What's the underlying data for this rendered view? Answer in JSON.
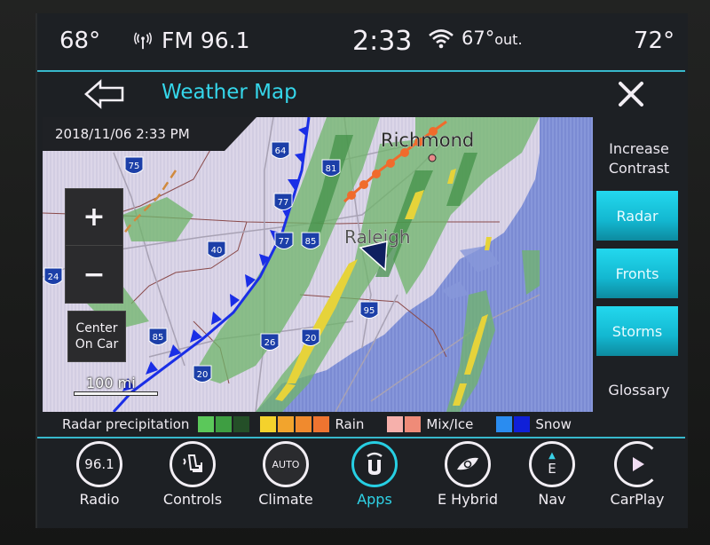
{
  "status_bar": {
    "driver_temp": "68°",
    "radio_icon": "radio-antenna-icon",
    "radio_station": "FM 96.1",
    "clock": "2:33",
    "wifi_icon": "wifi-icon",
    "outside_temp": "67°",
    "outside_suffix": "out.",
    "passenger_temp": "72°"
  },
  "header": {
    "back_icon": "back-arrow-icon",
    "title": "Weather Map",
    "close_icon": "close-icon"
  },
  "map": {
    "timestamp": "2018/11/06  2:33 PM",
    "zoom_in_label": "+",
    "zoom_out_label": "−",
    "center_on_car_label_line1": "Center",
    "center_on_car_label_line2": "On Car",
    "scale_label": "100 mi",
    "cities": [
      "Richmond",
      "Raleigh"
    ],
    "highway_shields": [
      "64",
      "75",
      "81",
      "77",
      "77",
      "85",
      "40",
      "24",
      "85",
      "26",
      "20",
      "20",
      "95",
      "19"
    ],
    "vehicle_icon": "vehicle-position-icon"
  },
  "side_panel": {
    "increase_contrast_line1": "Increase",
    "increase_contrast_line2": "Contrast",
    "toggles": [
      {
        "label": "Radar",
        "active": true
      },
      {
        "label": "Fronts",
        "active": true
      },
      {
        "label": "Storms",
        "active": true
      }
    ],
    "glossary": "Glossary"
  },
  "legend": {
    "title": "Radar precipitation",
    "groups": [
      {
        "label": "",
        "colors": [
          "#5bc85a",
          "#3e9e42",
          "#244f28"
        ]
      },
      {
        "label": "Rain",
        "colors": [
          "#f4d22c",
          "#f2a42d",
          "#f08a2e",
          "#ee7430"
        ]
      },
      {
        "label": "Mix/Ice",
        "colors": [
          "#f6b0ab",
          "#ef8b78"
        ]
      },
      {
        "label": "Snow",
        "colors": [
          "#2a8cf0",
          "#1020d8"
        ]
      }
    ]
  },
  "dock": {
    "items": [
      {
        "label": "Radio",
        "icon_text": "96.1",
        "icon": "radio-icon",
        "active": false
      },
      {
        "label": "Controls",
        "icon_text": "",
        "icon": "seat-controls-icon",
        "active": false
      },
      {
        "label": "Climate",
        "icon_text": "AUTO",
        "icon": "climate-icon",
        "active": false
      },
      {
        "label": "Apps",
        "icon_text": "",
        "icon": "uconnect-apps-icon",
        "active": true
      },
      {
        "label": "E Hybrid",
        "icon_text": "",
        "icon": "hybrid-eye-icon",
        "active": false
      },
      {
        "label": "Nav",
        "icon_text": "E",
        "icon": "compass-icon",
        "active": false
      },
      {
        "label": "CarPlay",
        "icon_text": "",
        "icon": "carplay-icon",
        "active": false
      }
    ]
  },
  "colors": {
    "accent": "#35d6ea",
    "toggle_active": "#1cc8e0",
    "cold_front": "#1a2ee6",
    "warm_front": "#f06b2c",
    "land": "#dcd6e8",
    "water": "#7f8fd6"
  }
}
